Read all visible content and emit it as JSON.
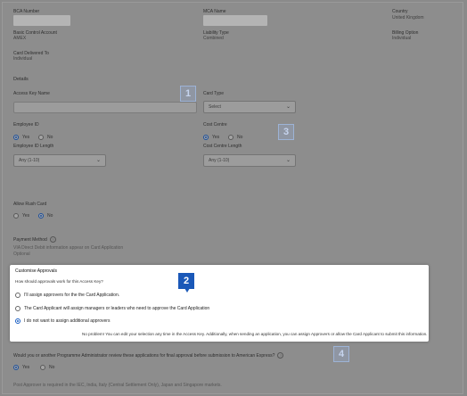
{
  "header": {
    "bca_number_label": "BCA Number",
    "mca_name_label": "MCA Name",
    "country_label": "Country",
    "country_value": "United Kingdom",
    "basic_control_label": "Basic Control Account",
    "basic_control_value": "AMEX",
    "liability_label": "Liability Type",
    "liability_value": "Combined",
    "billing_label": "Billing Option",
    "billing_value": "Individual",
    "card_delivered_label": "Card Delivered To",
    "card_delivered_value": "Individual"
  },
  "details": {
    "heading": "Details",
    "access_key_label": "Access Key Name",
    "card_type_label": "Card Type",
    "card_type_value": "Select",
    "employee_id_label": "Employee ID",
    "cost_centre_label": "Cost Centre",
    "yes_label": "Yes",
    "no_label": "No",
    "employee_id_length_label": "Employee ID Length",
    "employee_id_length_value": "Any (1-10)",
    "cost_centre_length_label": "Cost Centre Length",
    "cost_centre_length_value": "Any (1-10)",
    "rush_card_label": "Allow Rush Card",
    "payment_method_label": "Payment Method",
    "payment_method_note": "VIA Direct Debit information appear on Card Application",
    "payment_method_value": "Optional"
  },
  "approvals": {
    "title": "Customise Approvals",
    "question": "How should approvals work for this Access Key?",
    "options": [
      "I'll assign approvers for the the Card Application.",
      "The Card Applicant will assign managers or leaders who need to approve the Card Application",
      "I do not want to assign additional approvers"
    ],
    "note": "No problem! You can edit your selection any time in the Access Key. Additionally, when sending an application, you can assign Approvers or allow the Card Applicant to submit this information."
  },
  "final_review": {
    "question": "Would you or another Programme Administrator review these applications for final approval before submission to American Express?",
    "note": "Post Approver is required in the IEC, India, Italy (Central Settlement Only), Japan and Singapore markets."
  },
  "badges": [
    "1",
    "2",
    "3",
    "4"
  ],
  "icons": {
    "chevron": "chevron-down-icon",
    "help": "question-circle-icon"
  }
}
